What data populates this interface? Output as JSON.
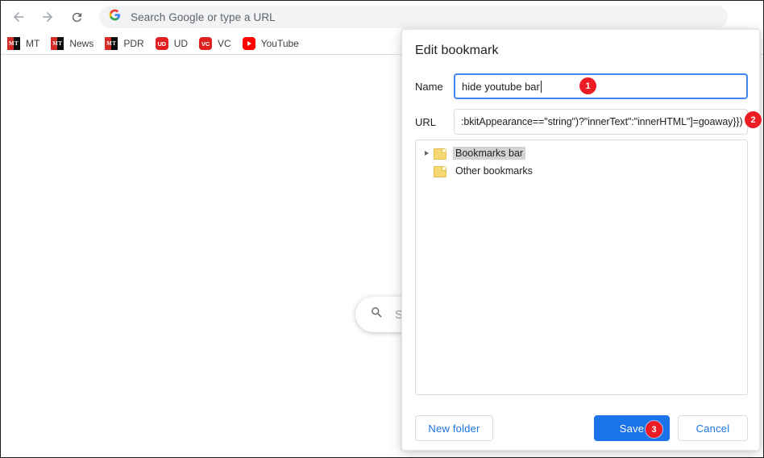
{
  "browser": {
    "nav": {
      "back_icon": "arrow-left-icon",
      "forward_icon": "arrow-right-icon",
      "reload_icon": "reload-icon"
    },
    "omnibox": {
      "placeholder": "Search Google or type a URL",
      "leading_icon": "google-g-icon",
      "value": ""
    },
    "bookmarks": [
      {
        "label": "MT",
        "icon": "mt-favicon",
        "icon_text": "MT"
      },
      {
        "label": "News",
        "icon": "mt-favicon",
        "icon_text": "MT"
      },
      {
        "label": "PDR",
        "icon": "mt-favicon",
        "icon_text": "MT"
      },
      {
        "label": "UD",
        "icon": "ud-favicon",
        "icon_text": "UD"
      },
      {
        "label": "VC",
        "icon": "vc-favicon",
        "icon_text": "VC"
      },
      {
        "label": "YouTube",
        "icon": "youtube-favicon",
        "icon_text": ""
      }
    ]
  },
  "page": {
    "search_box": {
      "icon": "search-icon",
      "text": "S"
    }
  },
  "dialog": {
    "title": "Edit bookmark",
    "name_field": {
      "label": "Name",
      "value": "hide youtube bar"
    },
    "url_field": {
      "label": "URL",
      "value": ":bkitAppearance==\"string\")?\"innerText\":\"innerHTML\"]=goaway}})();"
    },
    "tree": [
      {
        "label": "Bookmarks bar",
        "icon": "folder-icon",
        "selected": true,
        "expandable": true
      },
      {
        "label": "Other bookmarks",
        "icon": "folder-icon",
        "selected": false,
        "expandable": false
      }
    ],
    "buttons": {
      "new_folder": "New folder",
      "save": "Save",
      "cancel": "Cancel"
    }
  },
  "badges": {
    "one": "1",
    "two": "2",
    "three": "3"
  },
  "colors": {
    "accent_blue": "#1a73e8",
    "focus_blue": "#4285f4",
    "badge_red": "#ed1c24",
    "folder_yellow": "#f7d877",
    "selection_gray": "#d3d3d3"
  }
}
